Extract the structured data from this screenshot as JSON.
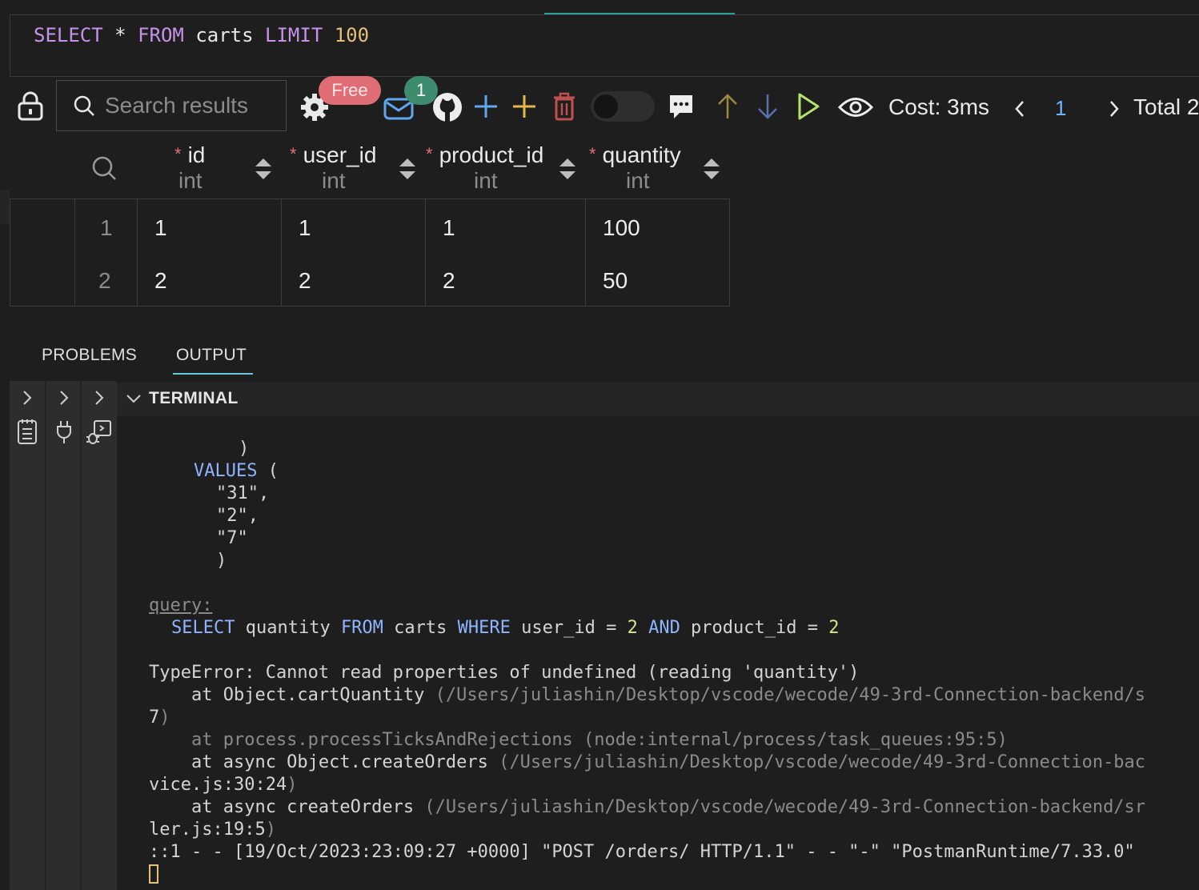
{
  "editor": {
    "query_tokens": [
      "SELECT",
      "*",
      "FROM",
      "carts",
      "LIMIT",
      "100"
    ]
  },
  "toolbar": {
    "search_placeholder": "Search results",
    "free_badge": "Free",
    "notification_count": "1",
    "cost_label": "Cost: 3ms",
    "page_number": "1",
    "total_label": "Total 2"
  },
  "table": {
    "columns": [
      {
        "name": "id",
        "type": "int",
        "required": "*"
      },
      {
        "name": "user_id",
        "type": "int",
        "required": "*"
      },
      {
        "name": "product_id",
        "type": "int",
        "required": "*"
      },
      {
        "name": "quantity",
        "type": "int",
        "required": "*"
      }
    ],
    "rows": [
      {
        "row": "1",
        "cells": [
          "1",
          "1",
          "1",
          "100"
        ]
      },
      {
        "row": "2",
        "cells": [
          "2",
          "2",
          "2",
          "50"
        ]
      }
    ]
  },
  "panel": {
    "tabs": [
      "PROBLEMS",
      "OUTPUT"
    ],
    "active_tab": "OUTPUT",
    "terminal_title": "TERMINAL"
  },
  "terminal": {
    "l1": ")",
    "l2_kw": "VALUES",
    "l2_rest": " (",
    "l3": "\"31\",",
    "l4": "\"2\",",
    "l5": "\"7\"",
    "l6": ")",
    "query_label": "query:",
    "q_select": "SELECT",
    "q_quantity": " quantity ",
    "q_from": "FROM",
    "q_carts": " carts ",
    "q_where": "WHERE",
    "q_userid": " user_id = ",
    "q_2a": "2",
    "q_and": " AND",
    "q_productid": " product_id = ",
    "q_2b": "2",
    "error": "TypeError: Cannot read properties of undefined (reading 'quantity')",
    "at1_a": "    at Object.cartQuantity ",
    "at1_b": "(/Users/juliashin/Desktop/vscode/wecode/49-3rd-Connection-backend/s",
    "at1_c": "7",
    "at1_d": ")",
    "at2": "    at process.processTicksAndRejections (node:internal/process/task_queues:95:5)",
    "at3_a": "    at async Object.createOrders ",
    "at3_b": "(/Users/juliashin/Desktop/vscode/wecode/49-3rd-Connection-bac",
    "at3_c": "vice.js:30:24",
    "at3_d": ")",
    "at4_a": "    at async createOrders ",
    "at4_b": "(/Users/juliashin/Desktop/vscode/wecode/49-3rd-Connection-backend/sr",
    "at4_c": "ler.js:19:5",
    "at4_d": ")",
    "log": "::1 - - [19/Oct/2023:23:09:27 +0000] \"POST /orders/ HTTP/1.1\" - - \"-\" \"PostmanRuntime/7.33.0\""
  },
  "colors": {
    "accent_teal": "#2aa198",
    "keyword_purple": "#c792ea",
    "number_yellow": "#e5c07b",
    "terminal_keyword_blue": "#8fb4ff",
    "required_red": "#e06c75",
    "badge_free": "#e06c75",
    "badge_count": "#3d8c6e"
  },
  "icons": [
    "lock-icon",
    "search-icon",
    "gear-icon",
    "mail-icon",
    "github-icon",
    "add-row-icon",
    "add-column-icon",
    "delete-icon",
    "comment-icon",
    "arrow-up-icon",
    "arrow-down-icon",
    "run-icon",
    "eye-icon",
    "chevron-left-icon",
    "chevron-right-icon"
  ]
}
